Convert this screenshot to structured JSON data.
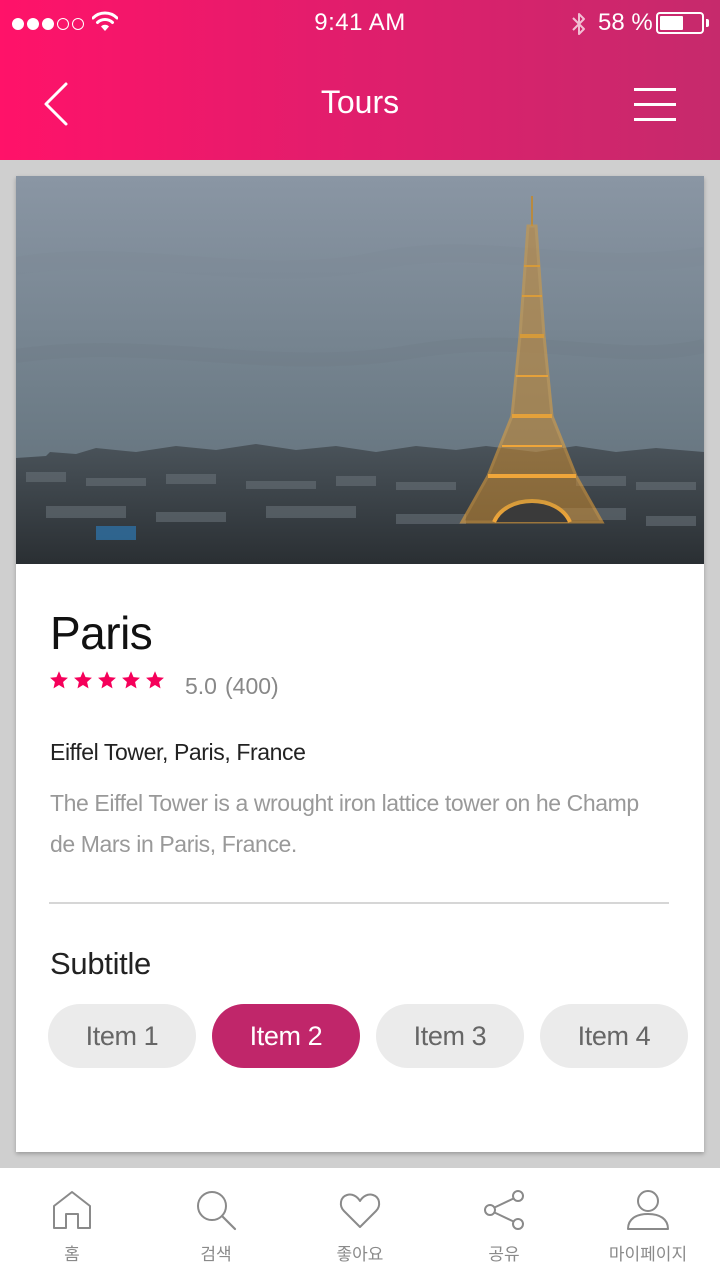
{
  "status_bar": {
    "time": "9:41 AM",
    "battery_percent": "58 %",
    "battery_level": 0.58,
    "signal_bars_filled": 3,
    "signal_bars_total": 5
  },
  "nav": {
    "title": "Tours",
    "back_icon": "chevron-left-icon",
    "menu_icon": "hamburger-menu-icon"
  },
  "tour": {
    "image_subject": "Eiffel Tower at dusk over Paris skyline",
    "name": "Paris",
    "rating_stars": 5,
    "rating_score": "5.0",
    "rating_count": "(400)",
    "location": "Eiffel Tower, Paris, France",
    "description": "The Eiffel Tower is a wrought iron lattice tower on he Champ de Mars in Paris, France."
  },
  "section": {
    "subtitle": "Subtitle",
    "items": [
      {
        "label": "Item 1",
        "selected": false
      },
      {
        "label": "Item 2",
        "selected": true
      },
      {
        "label": "Item 3",
        "selected": false
      },
      {
        "label": "Item 4",
        "selected": false
      }
    ]
  },
  "tab_bar": {
    "tabs": [
      {
        "label": "홈",
        "icon": "home-icon"
      },
      {
        "label": "검색",
        "icon": "search-icon"
      },
      {
        "label": "좋아요",
        "icon": "heart-icon"
      },
      {
        "label": "공유",
        "icon": "share-icon"
      },
      {
        "label": "마이페이지",
        "icon": "user-icon"
      }
    ]
  },
  "colors": {
    "header_gradient_start": "#ff1269",
    "header_gradient_end": "#c62a6c",
    "accent": "#c0266a",
    "star": "#f5005a",
    "chip_inactive": "#ebebeb"
  }
}
